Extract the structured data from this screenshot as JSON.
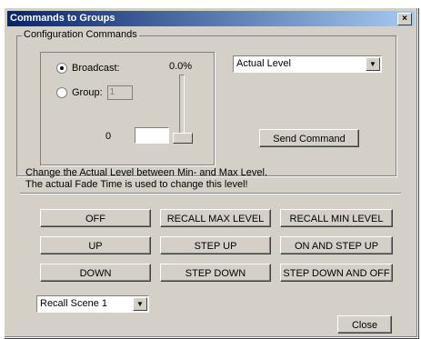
{
  "dialog": {
    "title": "Commands to Groups",
    "close_glyph": "×"
  },
  "config": {
    "group_label": "Configuration Commands",
    "broadcast_label": "Broadcast:",
    "group_radio_label": "Group:",
    "group_value": "1",
    "percent": "0.0%",
    "level_min": "0",
    "level_value": "",
    "selected_broadcast": true
  },
  "command_combo": {
    "value": "Actual Level"
  },
  "send_button": "Send Command",
  "description": {
    "line1": "Change the Actual Level between Min- and Max Level.",
    "line2": "The actual Fade Time is used to change this level!"
  },
  "buttons": {
    "off": "OFF",
    "recall_max": "RECALL MAX LEVEL",
    "recall_min": "RECALL MIN LEVEL",
    "up": "UP",
    "step_up": "STEP UP",
    "on_and_step_up": "ON AND STEP UP",
    "down": "DOWN",
    "step_down": "STEP DOWN",
    "step_down_and_off": "STEP DOWN AND OFF"
  },
  "scene_combo": {
    "value": "Recall Scene 1"
  },
  "close_button": "Close",
  "colors": {
    "face": "#d4d0c8",
    "title_start": "#0a246a",
    "title_end": "#a6caf0"
  },
  "icons": [
    "close-icon",
    "dropdown-arrow-icon"
  ]
}
